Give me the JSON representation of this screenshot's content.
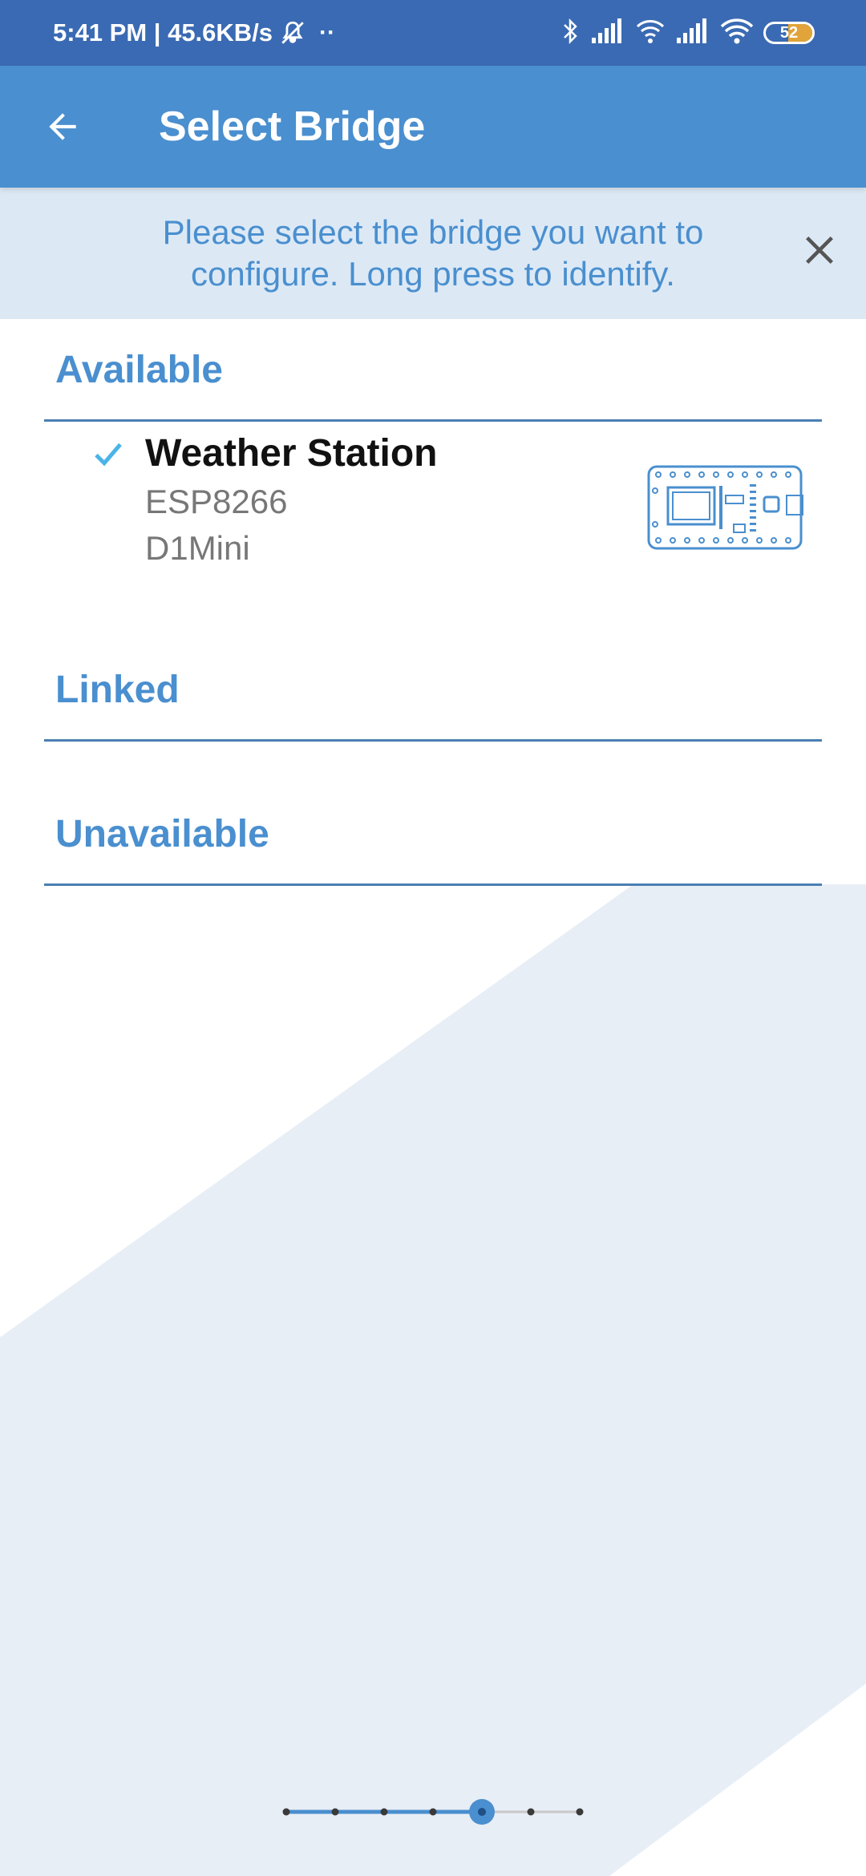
{
  "status_bar": {
    "time": "5:41 PM",
    "network_speed": "45.6KB/s",
    "icons": [
      "mute-bell-icon",
      "more-dots-icon",
      "bluetooth-icon",
      "signal-icon",
      "hotspot-icon",
      "signal-icon",
      "wifi-icon"
    ],
    "battery": {
      "level": "52",
      "fraction": 0.52
    }
  },
  "app_bar": {
    "title": "Select Bridge",
    "back_icon": "arrow-left-icon"
  },
  "banner": {
    "text": "Please select the bridge you want to configure. Long press to identify.",
    "close_icon": "close-icon"
  },
  "sections": {
    "available": "Available",
    "linked": "Linked",
    "unavailable": "Unavailable"
  },
  "bridges": [
    {
      "name": "Weather Station",
      "chip": "ESP8266",
      "board": "D1Mini",
      "selected": true,
      "icon": "board-icon"
    }
  ],
  "pager": {
    "total_steps": 7,
    "current_step": 5
  },
  "colors": {
    "status_bar": "#3a6ab3",
    "app_bar": "#4a8fcf",
    "accent": "#4a8fcf",
    "banner_bg": "#dce9f5",
    "check": "#4ab4e8",
    "background_shape": "#e8eef6"
  }
}
